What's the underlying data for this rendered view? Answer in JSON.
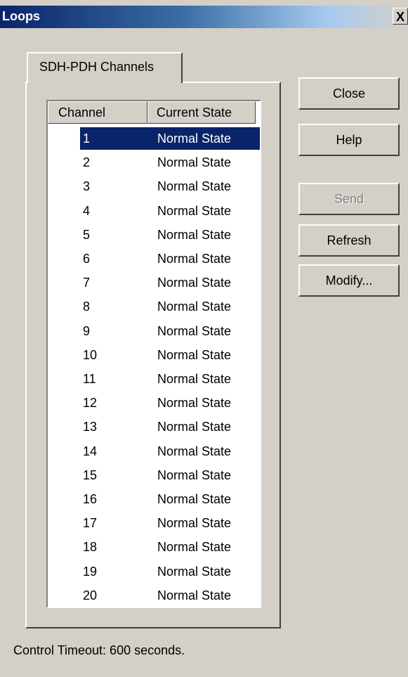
{
  "window": {
    "title": "Loops",
    "close_glyph": "X"
  },
  "tabs": [
    {
      "label": "SDH-PDH Channels"
    }
  ],
  "list": {
    "columns": [
      "Channel",
      "Current State"
    ],
    "selected_index": 0,
    "rows": [
      {
        "channel": "1",
        "state": "Normal State"
      },
      {
        "channel": "2",
        "state": "Normal State"
      },
      {
        "channel": "3",
        "state": "Normal State"
      },
      {
        "channel": "4",
        "state": "Normal State"
      },
      {
        "channel": "5",
        "state": "Normal State"
      },
      {
        "channel": "6",
        "state": "Normal State"
      },
      {
        "channel": "7",
        "state": "Normal State"
      },
      {
        "channel": "8",
        "state": "Normal State"
      },
      {
        "channel": "9",
        "state": "Normal State"
      },
      {
        "channel": "10",
        "state": "Normal State"
      },
      {
        "channel": "11",
        "state": "Normal State"
      },
      {
        "channel": "12",
        "state": "Normal State"
      },
      {
        "channel": "13",
        "state": "Normal State"
      },
      {
        "channel": "14",
        "state": "Normal State"
      },
      {
        "channel": "15",
        "state": "Normal State"
      },
      {
        "channel": "16",
        "state": "Normal State"
      },
      {
        "channel": "17",
        "state": "Normal State"
      },
      {
        "channel": "18",
        "state": "Normal State"
      },
      {
        "channel": "19",
        "state": "Normal State"
      },
      {
        "channel": "20",
        "state": "Normal State"
      }
    ]
  },
  "buttons": {
    "close": "Close",
    "help": "Help",
    "send": "Send",
    "refresh": "Refresh",
    "modify": "Modify..."
  },
  "status": {
    "text": "Control Timeout: 600 seconds."
  },
  "colors": {
    "face": "#d4d0c8",
    "selection": "#0a246a",
    "title_start": "#0a246a"
  }
}
